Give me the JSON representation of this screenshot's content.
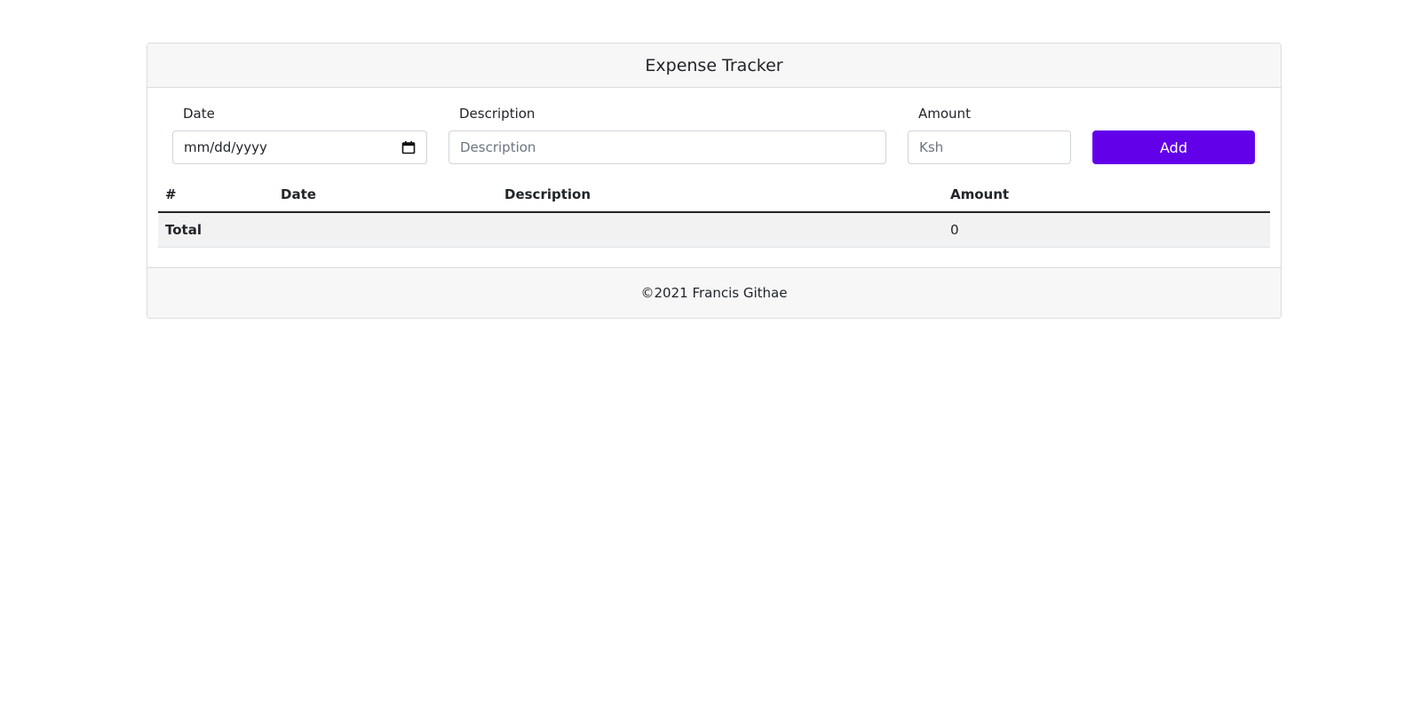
{
  "header": {
    "title": "Expense Tracker"
  },
  "form": {
    "date_label": "Date",
    "date_value": "mm/dd/yyyy",
    "description_label": "Description",
    "description_placeholder": "Description",
    "amount_label": "Amount",
    "amount_placeholder": "Ksh",
    "add_label": "Add"
  },
  "table": {
    "columns": [
      "#",
      "Date",
      "Description",
      "Amount"
    ],
    "rows": [],
    "total_label": "Total",
    "total_value": "0"
  },
  "footer": {
    "text": "©2021 Francis Githae"
  },
  "colors": {
    "accent": "#6200ea",
    "header_bg": "#f7f7f7"
  },
  "icons": {
    "date_picker": "calendar-icon"
  }
}
